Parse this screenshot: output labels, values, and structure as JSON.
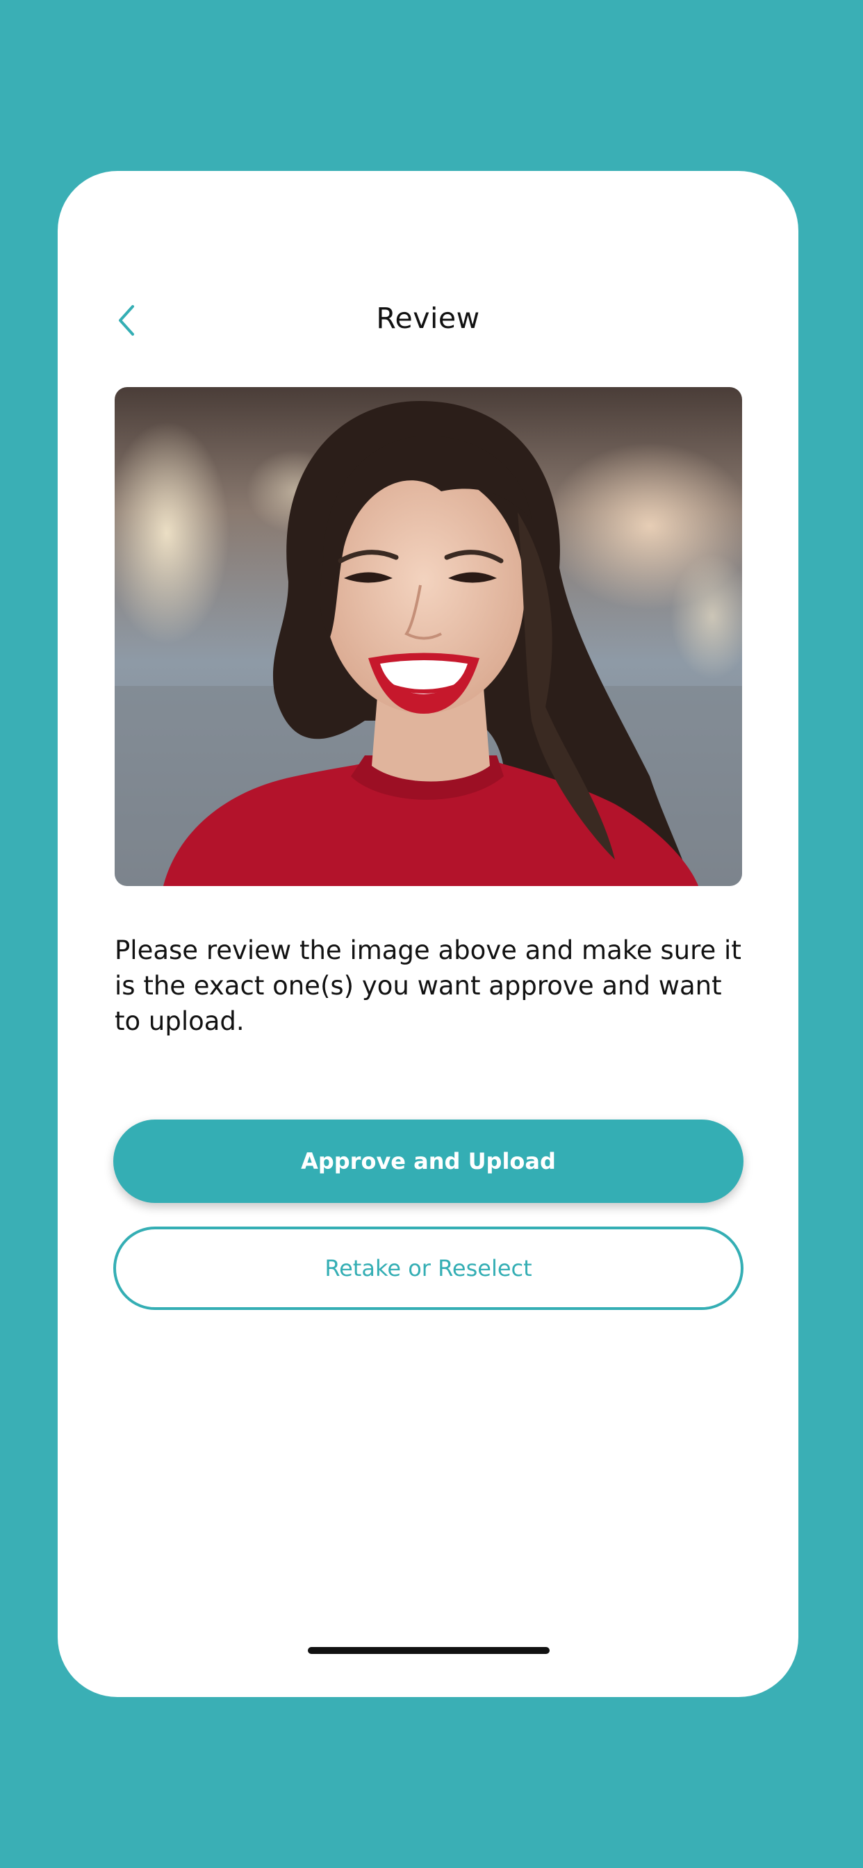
{
  "header": {
    "title": "Review",
    "back_icon": "chevron-left-icon"
  },
  "review": {
    "photo_alt": "",
    "instructions": "Please review the image above and make sure it is the exact one(s) you want approve and want to upload."
  },
  "actions": {
    "approve_label": "Approve and Upload",
    "retake_label": "Retake or Reselect"
  },
  "colors": {
    "background": "#3aafb5",
    "accent": "#34aeb4",
    "card": "#ffffff",
    "text": "#111111"
  }
}
